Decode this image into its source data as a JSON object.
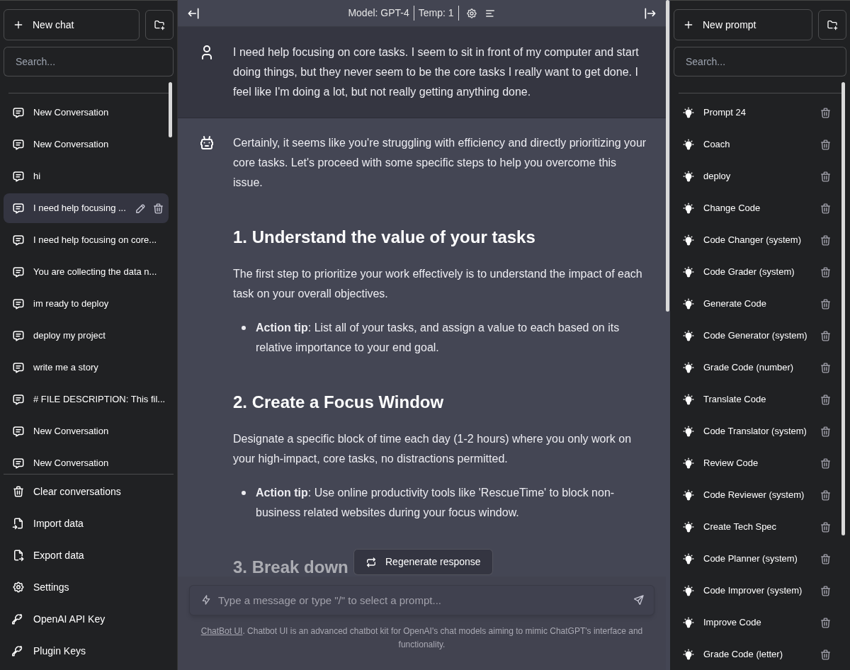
{
  "left_sidebar": {
    "new_chat_button": "New chat",
    "search": {
      "placeholder": "Search..."
    },
    "conversations": [
      {
        "title": "New Conversation",
        "selected": false
      },
      {
        "title": "New Conversation",
        "selected": false
      },
      {
        "title": "hi",
        "selected": false
      },
      {
        "title": "I need help focusing ...",
        "selected": true
      },
      {
        "title": "I need help focusing on core...",
        "selected": false
      },
      {
        "title": "You are collecting the data n...",
        "selected": false
      },
      {
        "title": "im ready to deploy",
        "selected": false
      },
      {
        "title": "deploy my project",
        "selected": false
      },
      {
        "title": "write me a story",
        "selected": false
      },
      {
        "title": "# FILE DESCRIPTION: This fil...",
        "selected": false
      },
      {
        "title": "New Conversation",
        "selected": false
      },
      {
        "title": "New Conversation",
        "selected": false
      }
    ],
    "menu": [
      "Clear conversations",
      "Import data",
      "Export data",
      "Settings",
      "OpenAI API Key",
      "Plugin Keys"
    ]
  },
  "top_bar": {
    "model": "Model: GPT-4",
    "temperature": "Temp: 1"
  },
  "messages": [
    {
      "kind": "user",
      "blocks": [
        {
          "kind": "paragraph",
          "text": "I need help focusing on core tasks. I seem to sit in front of my computer and start doing things, but they never seem to be the core tasks I really want to get done. I feel like I'm doing a lot, but not really getting anything done."
        }
      ]
    },
    {
      "kind": "assistant",
      "blocks": [
        {
          "kind": "paragraph",
          "text": "Certainly, it seems like you're struggling with efficiency and directly prioritizing your core tasks. Let's proceed with some specific steps to help you overcome this issue."
        },
        {
          "kind": "heading",
          "text": "1. Understand the value of your tasks"
        },
        {
          "kind": "paragraph",
          "text": "The first step to prioritize your work effectively is to understand the impact of each task on your overall objectives."
        },
        {
          "kind": "bullet",
          "text": "**Action tip**: List all of your tasks, and assign a value to each based on its relative importance to your end goal."
        },
        {
          "kind": "heading",
          "text": "2. Create a Focus Window"
        },
        {
          "kind": "paragraph",
          "text": "Designate a specific block of time each day (1-2 hours) where you only work on your high-impact, core tasks, no distractions permitted."
        },
        {
          "kind": "bullet",
          "text": "**Action tip**: Use online productivity tools like 'RescueTime' to block non-business related websites during your focus window."
        },
        {
          "kind": "heading",
          "text": "3. Break down"
        }
      ]
    }
  ],
  "regenerate_button": "Regenerate response",
  "message_input": {
    "placeholder": "Type a message or type \"/\" to select a prompt..."
  },
  "footer": {
    "link": "ChatBot UI",
    "text": ". Chatbot UI is an advanced chatbot kit for OpenAI's chat models aiming to mimic ChatGPT's interface and functionality."
  },
  "right_sidebar": {
    "new_prompt_button": "New prompt",
    "search": {
      "placeholder": "Search..."
    },
    "prompts": [
      "Prompt 24",
      "Coach",
      "deploy",
      "Change Code",
      "Code Changer (system)",
      "Code Grader (system)",
      "Generate Code",
      "Code Generator (system)",
      "Grade Code (number)",
      "Translate Code",
      "Code Translator (system)",
      "Review Code",
      "Code Reviewer (system)",
      "Create Tech Spec",
      "Code Planner (system)",
      "Code Improver (system)",
      "Improve Code",
      "Grade Code (letter)"
    ]
  }
}
